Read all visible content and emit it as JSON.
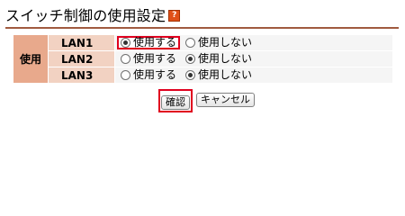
{
  "title": "スイッチ制御の使用設定",
  "help_icon_glyph": "?",
  "group_label": "使用",
  "rows": [
    {
      "lan": "LAN1",
      "use_label": "使用する",
      "nouse_label": "使用しない",
      "selected": "use"
    },
    {
      "lan": "LAN2",
      "use_label": "使用する",
      "nouse_label": "使用しない",
      "selected": "nouse"
    },
    {
      "lan": "LAN3",
      "use_label": "使用する",
      "nouse_label": "使用しない",
      "selected": "nouse"
    }
  ],
  "buttons": {
    "confirm": "確認",
    "cancel": "キャンセル"
  },
  "colors": {
    "highlight": "#e0001e",
    "group_bg": "#e8a98c",
    "lan_bg": "#f2d2c2",
    "title_rule": "#a05a40"
  }
}
